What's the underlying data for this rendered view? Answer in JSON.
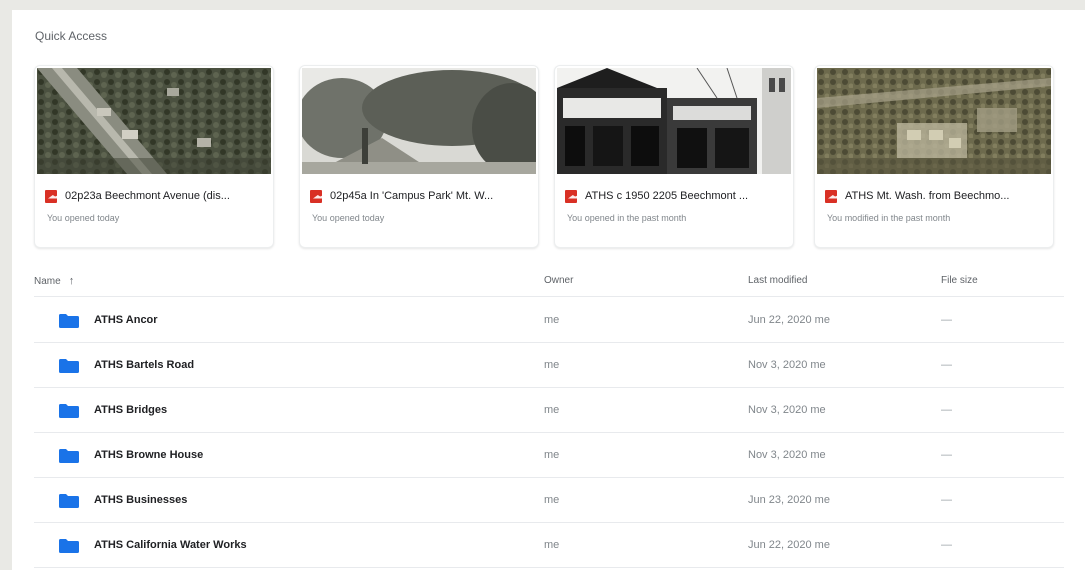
{
  "quick_access": {
    "title": "Quick Access",
    "cards": [
      {
        "name": "02p23a Beechmont Avenue (dis...",
        "subtitle": "You opened today",
        "file_icon": "pdf-icon",
        "thumbnail": "aerial-photo"
      },
      {
        "name": "02p45a In 'Campus Park' Mt. W...",
        "subtitle": "You opened today",
        "file_icon": "pdf-icon",
        "thumbnail": "park-photo"
      },
      {
        "name": "ATHS c 1950 2205 Beechmont ...",
        "subtitle": "You opened in the past month",
        "file_icon": "pdf-icon",
        "thumbnail": "storefront-photo"
      },
      {
        "name": "ATHS Mt. Wash. from Beechmo...",
        "subtitle": "You modified in the past month",
        "file_icon": "pdf-icon",
        "thumbnail": "aerial-photo-2"
      }
    ]
  },
  "file_list": {
    "columns": {
      "name": "Name",
      "owner": "Owner",
      "last_modified": "Last modified",
      "file_size": "File size"
    },
    "sort_icon": "arrow-up-icon",
    "rows": [
      {
        "name": "ATHS Ancor",
        "owner": "me",
        "modified": "Jun 22, 2020 me",
        "size": "—"
      },
      {
        "name": "ATHS Bartels Road",
        "owner": "me",
        "modified": "Nov 3, 2020 me",
        "size": "—"
      },
      {
        "name": "ATHS Bridges",
        "owner": "me",
        "modified": "Nov 3, 2020 me",
        "size": "—"
      },
      {
        "name": "ATHS Browne House",
        "owner": "me",
        "modified": "Nov 3, 2020 me",
        "size": "—"
      },
      {
        "name": "ATHS Businesses",
        "owner": "me",
        "modified": "Jun 23, 2020 me",
        "size": "—"
      },
      {
        "name": "ATHS California Water Works",
        "owner": "me",
        "modified": "Jun 22, 2020 me",
        "size": "—"
      }
    ]
  },
  "colors": {
    "folder": "#1a73e8",
    "pdf": "#d93025",
    "background": "#e9e9e5"
  }
}
